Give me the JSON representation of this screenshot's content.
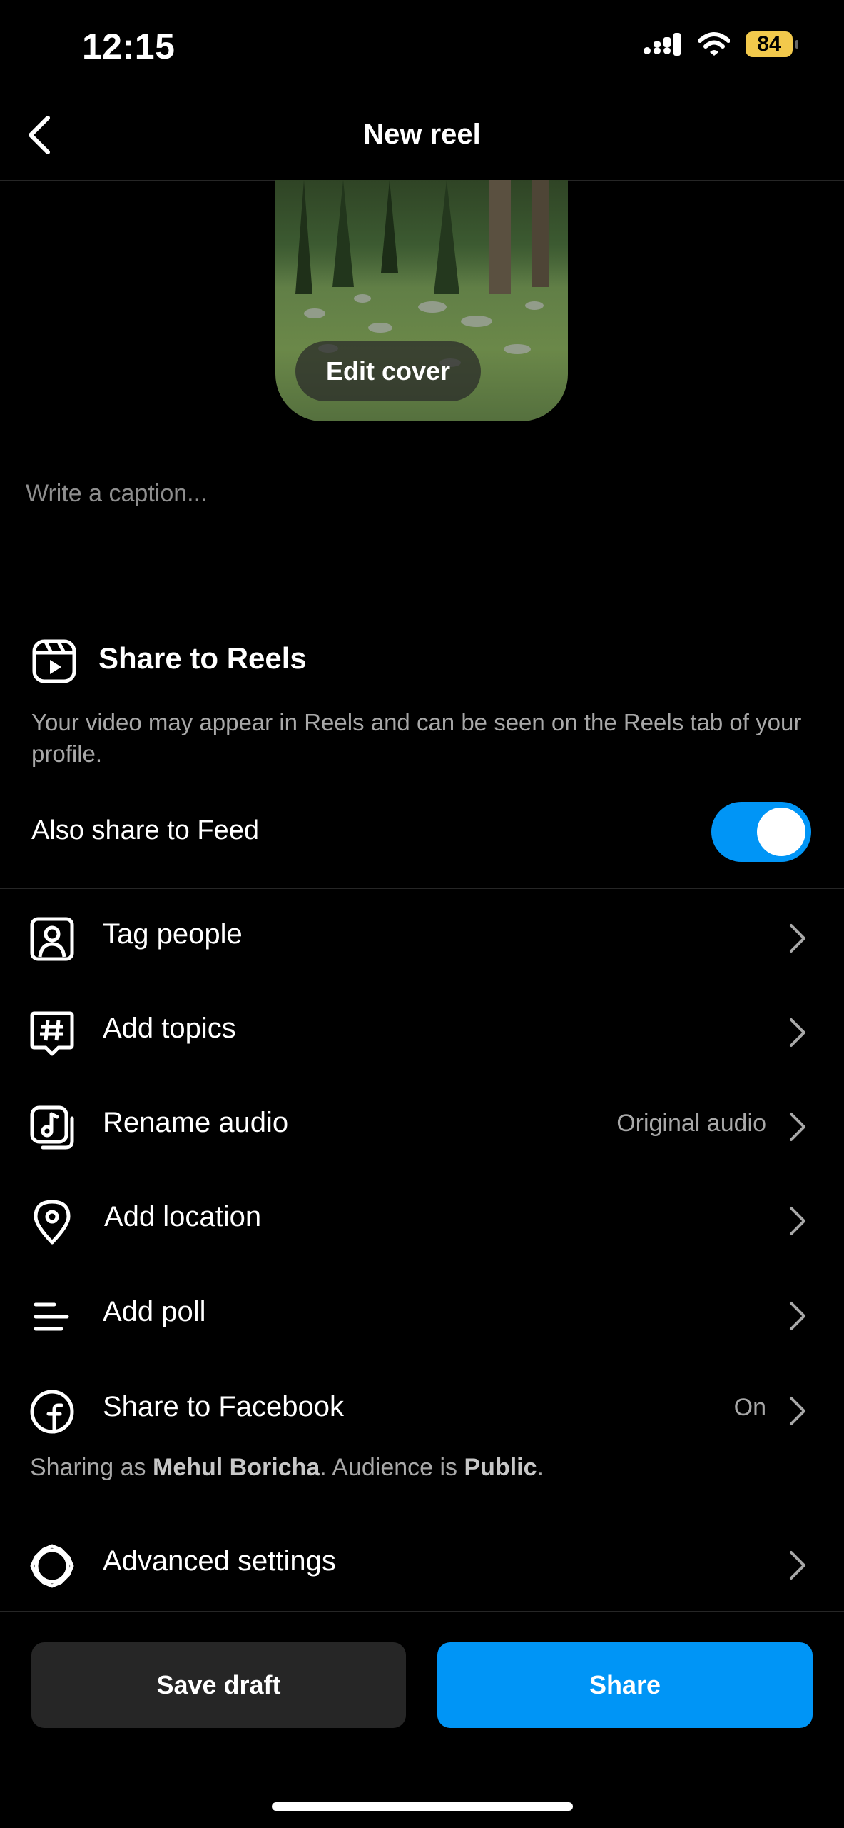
{
  "status_bar": {
    "time": "12:15",
    "battery": "84"
  },
  "header": {
    "title": "New reel"
  },
  "cover": {
    "edit_label": "Edit cover"
  },
  "caption": {
    "placeholder": "Write a caption..."
  },
  "share_to_reels": {
    "title": "Share to Reels",
    "description": "Your video may appear in Reels and can be seen on the Reels tab of your profile.",
    "feed_toggle_label": "Also share to Feed",
    "feed_toggle_on": true
  },
  "menu": {
    "tag_people": {
      "label": "Tag people"
    },
    "add_topics": {
      "label": "Add topics"
    },
    "rename_audio": {
      "label": "Rename audio",
      "value": "Original audio"
    },
    "add_location": {
      "label": "Add location"
    },
    "add_poll": {
      "label": "Add poll"
    },
    "share_facebook": {
      "label": "Share to Facebook",
      "value": "On"
    },
    "advanced_settings": {
      "label": "Advanced settings"
    }
  },
  "facebook_note": {
    "prefix": "Sharing as ",
    "name": "Mehul Boricha",
    "middle": ". Audience is ",
    "audience": "Public",
    "suffix": "."
  },
  "actions": {
    "save_draft": "Save draft",
    "share": "Share"
  },
  "colors": {
    "accent": "#0095f6",
    "background": "#000000",
    "secondary_text": "#a8a8a8",
    "battery": "#f2c94c"
  }
}
